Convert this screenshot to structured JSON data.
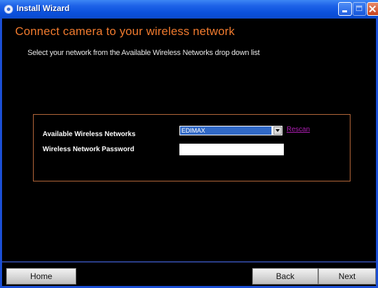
{
  "window": {
    "title": "Install Wizard"
  },
  "page": {
    "heading": "Connect camera to your wireless network",
    "instruction": "Select your network from the Available Wireless Networks drop down list"
  },
  "form": {
    "networks_label": "Available Wireless Networks",
    "networks_selected": "EDIMAX",
    "rescan_label": "Rescan",
    "password_label": "Wireless Network Password",
    "password_value": ""
  },
  "footer": {
    "home_label": "Home",
    "back_label": "Back",
    "next_label": "Next"
  },
  "colors": {
    "background": "#000000",
    "heading": "#f07a2e",
    "panel_border": "#b5673a",
    "link": "#b01fb5",
    "selection": "#3169c6",
    "titlebar": "#0a50dc"
  },
  "icons": {
    "app": "wizard-app-icon",
    "minimize": "minimize-icon",
    "maximize": "maximize-icon",
    "close": "close-icon",
    "dropdown": "chevron-down-icon"
  }
}
